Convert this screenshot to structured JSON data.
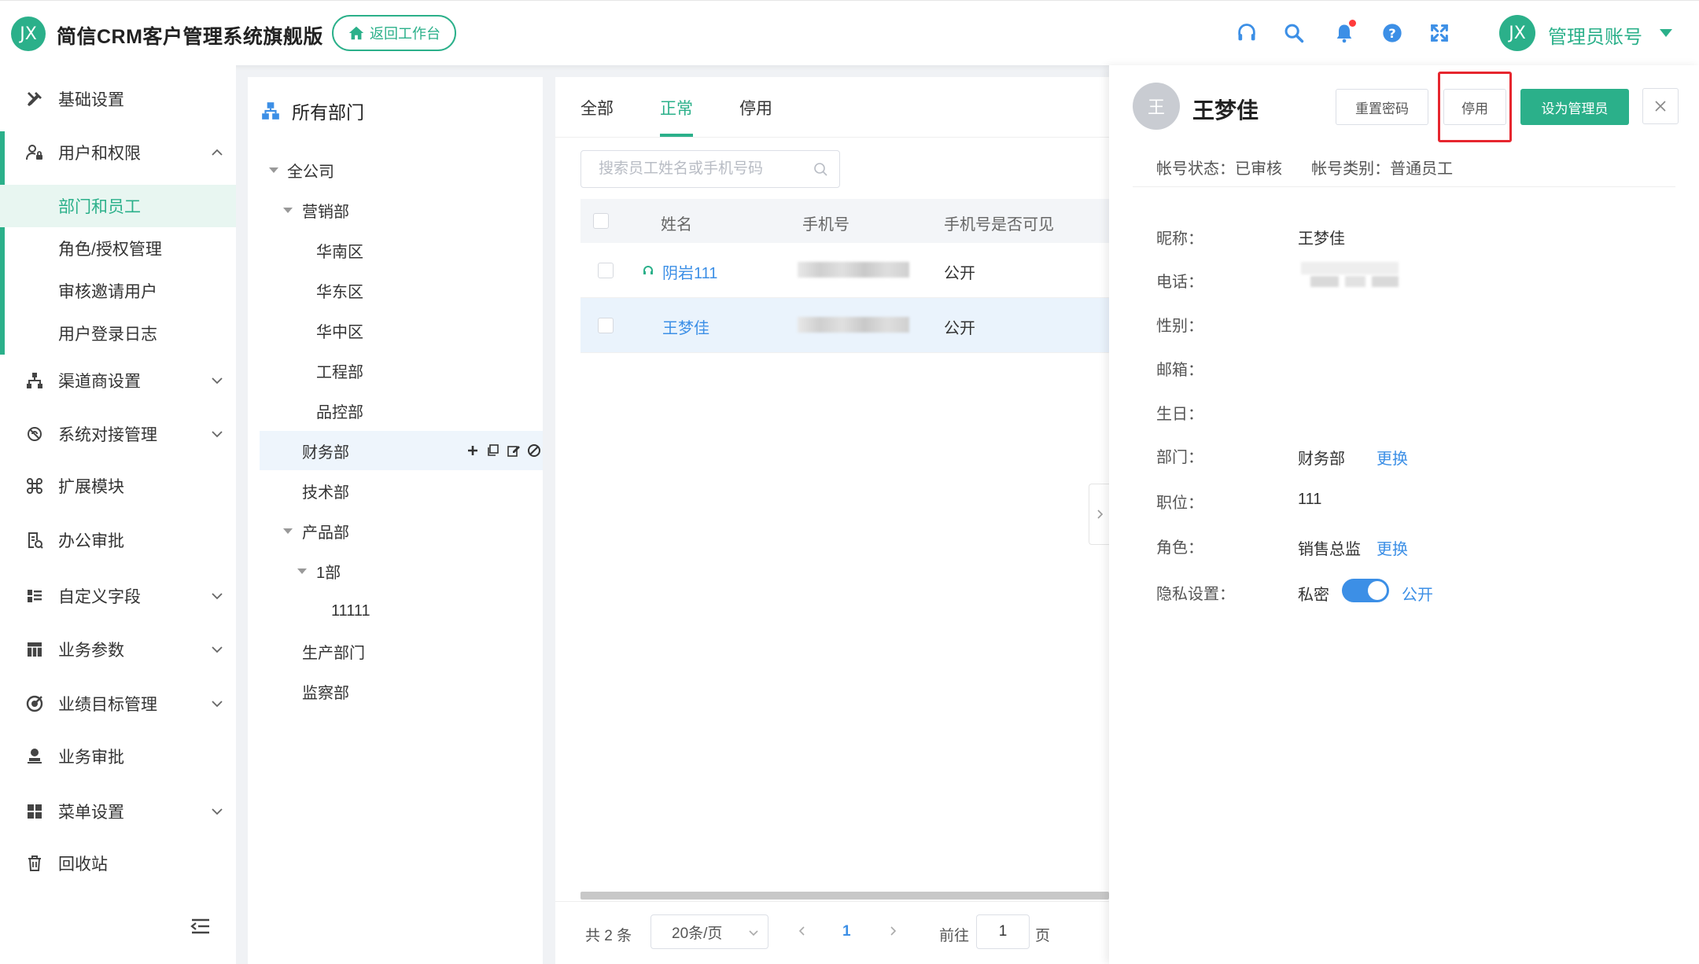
{
  "header": {
    "logo_text": "JX",
    "app_title": "简信CRM客户管理系统旗舰版",
    "back_button": "返回工作台",
    "avatar_text": "JX",
    "admin_name": "管理员账号",
    "icons": [
      "headset-icon",
      "search-icon",
      "bell-icon",
      "help-icon",
      "fullscreen-icon"
    ],
    "accent_color": "#2bb08a"
  },
  "sidebar": {
    "items": [
      {
        "label": "基础设置",
        "icon": "wrench-icon"
      },
      {
        "label": "用户和权限",
        "icon": "user-lock-icon",
        "expanded": true
      },
      {
        "label": "渠道商设置",
        "icon": "sitemap-icon"
      },
      {
        "label": "系统对接管理",
        "icon": "link-icon"
      },
      {
        "label": "扩展模块",
        "icon": "command-icon"
      },
      {
        "label": "办公审批",
        "icon": "document-check-icon"
      },
      {
        "label": "自定义字段",
        "icon": "list-icon"
      },
      {
        "label": "业务参数",
        "icon": "grid-table-icon"
      },
      {
        "label": "业绩目标管理",
        "icon": "target-icon"
      },
      {
        "label": "业务审批",
        "icon": "stamp-icon"
      },
      {
        "label": "菜单设置",
        "icon": "menu-grid-icon"
      },
      {
        "label": "回收站",
        "icon": "trash-icon"
      }
    ],
    "sub_items": [
      "部门和员工",
      "角色/授权管理",
      "审核邀请用户",
      "用户登录日志"
    ],
    "active_sub": "部门和员工"
  },
  "departments": {
    "title": "所有部门",
    "nodes": [
      {
        "label": "全公司",
        "level": 0,
        "expanded": true
      },
      {
        "label": "营销部",
        "level": 1,
        "expanded": true
      },
      {
        "label": "华南区",
        "level": 2
      },
      {
        "label": "华东区",
        "level": 2
      },
      {
        "label": "华中区",
        "level": 2
      },
      {
        "label": "工程部",
        "level": 2
      },
      {
        "label": "品控部",
        "level": 2
      },
      {
        "label": "财务部",
        "level": 1,
        "selected": true
      },
      {
        "label": "技术部",
        "level": 1
      },
      {
        "label": "产品部",
        "level": 1,
        "expanded": true
      },
      {
        "label": "1部",
        "level": 2,
        "expanded": true
      },
      {
        "label": "11111",
        "level": 3
      },
      {
        "label": "生产部门",
        "level": 1
      },
      {
        "label": "监察部",
        "level": 1
      }
    ]
  },
  "employee_list": {
    "tabs": [
      "全部",
      "正常",
      "停用"
    ],
    "active_tab": "正常",
    "search_placeholder": "搜索员工姓名或手机号码",
    "columns": [
      "姓名",
      "手机号",
      "手机号是否可见"
    ],
    "rows": [
      {
        "name": "阴岩111",
        "phone_visibility": "公开",
        "online_icon": true
      },
      {
        "name": "王梦佳",
        "phone_visibility": "公开",
        "highlighted": true
      }
    ],
    "pagination": {
      "total": "共 2 条",
      "page_size": "20条/页",
      "current_page": "1",
      "goto_label": "前往",
      "goto_value": "1",
      "page_suffix": "页"
    }
  },
  "detail": {
    "avatar_text": "王",
    "name": "王梦佳",
    "buttons": {
      "reset_password": "重置密码",
      "disable": "停用",
      "set_admin": "设为管理员"
    },
    "account_status": "帐号状态：已审核",
    "account_type": "帐号类别：普通员工",
    "fields": {
      "nickname_label": "昵称：",
      "nickname": "王梦佳",
      "phone_label": "电话：",
      "gender_label": "性别：",
      "email_label": "邮箱：",
      "birthday_label": "生日：",
      "dept_label": "部门：",
      "dept": "财务部",
      "dept_change": "更换",
      "position_label": "职位：",
      "position": "111",
      "role_label": "角色：",
      "role": "销售总监",
      "role_change": "更换",
      "privacy_label": "隐私设置：",
      "privacy_private": "私密",
      "privacy_public": "公开"
    },
    "privacy_public_on": true
  }
}
